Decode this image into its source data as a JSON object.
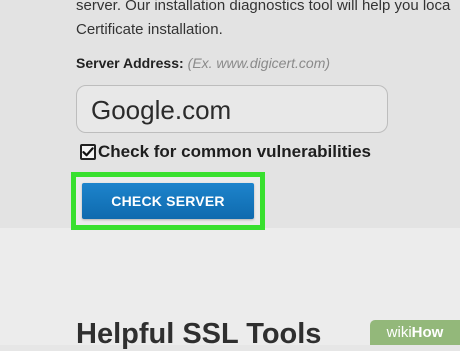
{
  "intro": {
    "line1": "server. Our installation diagnostics tool will help you loca",
    "line2": "Certificate installation."
  },
  "form": {
    "server_label": "Server Address:",
    "server_hint": "(Ex. www.digicert.com)",
    "server_value": "Google.com",
    "vuln_check_label": "Check for common vulnerabilities",
    "vuln_check_checked": true,
    "submit_label": "CHECK SERVER"
  },
  "section": {
    "heading": "Helpful SSL Tools"
  },
  "watermark": {
    "prefix": "wiki",
    "suffix": "How"
  },
  "colors": {
    "button": "#1577bf",
    "highlight": "#38e02e",
    "watermark": "#93b87a"
  }
}
